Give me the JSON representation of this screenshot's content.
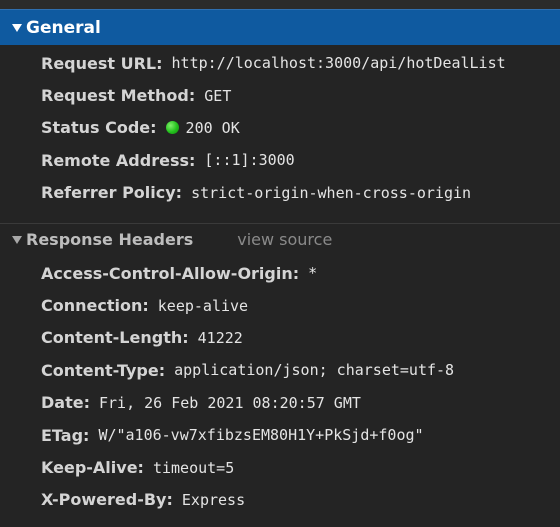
{
  "general": {
    "title": "General",
    "rows": [
      {
        "key": "Request URL:",
        "value": "http://localhost:3000/api/hotDealList"
      },
      {
        "key": "Request Method:",
        "value": "GET"
      },
      {
        "key": "Status Code:",
        "value": "200 OK",
        "status_color": "#22c01c"
      },
      {
        "key": "Remote Address:",
        "value": "[::1]:3000"
      },
      {
        "key": "Referrer Policy:",
        "value": "strict-origin-when-cross-origin"
      }
    ]
  },
  "response_headers": {
    "title": "Response Headers",
    "view_source_label": "view source",
    "rows": [
      {
        "key": "Access-Control-Allow-Origin:",
        "value": "*"
      },
      {
        "key": "Connection:",
        "value": "keep-alive"
      },
      {
        "key": "Content-Length:",
        "value": "41222"
      },
      {
        "key": "Content-Type:",
        "value": "application/json; charset=utf-8"
      },
      {
        "key": "Date:",
        "value": "Fri, 26 Feb 2021 08:20:57 GMT"
      },
      {
        "key": "ETag:",
        "value": "W/\"a106-vw7xfibzsEM80H1Y+PkSjd+f0og\""
      },
      {
        "key": "Keep-Alive:",
        "value": "timeout=5"
      },
      {
        "key": "X-Powered-By:",
        "value": "Express"
      }
    ]
  },
  "colors": {
    "selected_header_bg": "#0f5aa0",
    "panel_bg": "#242424",
    "status_ok": "#22c01c"
  }
}
